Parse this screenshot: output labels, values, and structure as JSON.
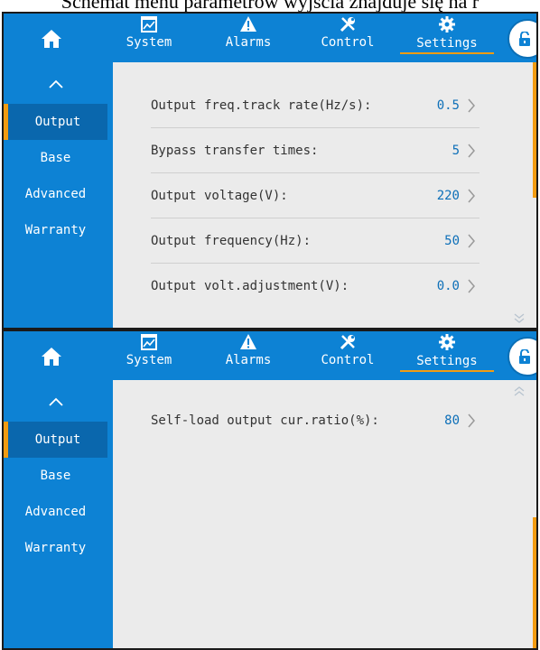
{
  "caption": "Schemat menu parametrów wyjścia znajduje się na r",
  "nav": {
    "tabs": [
      {
        "label": "System",
        "icon": "monitor-chart-icon"
      },
      {
        "label": "Alarms",
        "icon": "warning-icon"
      },
      {
        "label": "Control",
        "icon": "tools-icon"
      },
      {
        "label": "Settings",
        "icon": "gear-icon"
      }
    ],
    "active_tab": "Settings",
    "home_icon": "home-icon",
    "lock_icon": "unlock-icon"
  },
  "sidebar": {
    "items": [
      {
        "label": "Output"
      },
      {
        "label": "Base"
      },
      {
        "label": "Advanced"
      },
      {
        "label": "Warranty"
      }
    ],
    "active_item": "Output"
  },
  "screens": [
    {
      "rows": [
        {
          "label": "Output freq.track rate(Hz/s):",
          "value": "0.5"
        },
        {
          "label": "Bypass transfer times:",
          "value": "5"
        },
        {
          "label": "Output voltage(V):",
          "value": "220"
        },
        {
          "label": "Output frequency(Hz):",
          "value": "50"
        },
        {
          "label": "Output volt.adjustment(V):",
          "value": "0.0"
        }
      ]
    },
    {
      "rows": [
        {
          "label": "Self-load output cur.ratio(%):",
          "value": "80"
        }
      ]
    }
  ],
  "colors": {
    "accent": "#0d82d4",
    "highlight": "#f39c12",
    "value": "#0d6fb8"
  }
}
